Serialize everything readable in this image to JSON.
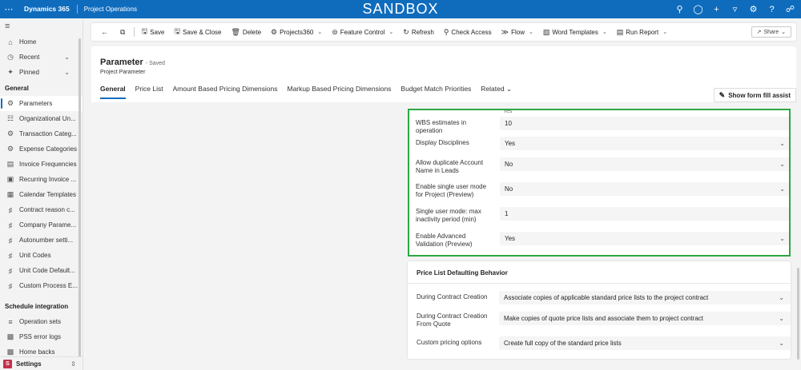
{
  "topbar": {
    "app_name": "Dynamics 365",
    "area_name": "Project Operations",
    "environment": "SANDBOX",
    "icons": [
      "search-icon",
      "lightbulb-icon",
      "plus-icon",
      "filter-icon",
      "gear-icon",
      "help-icon",
      "copilot-icon"
    ],
    "brand_color": "#0f6cbd"
  },
  "sidebar": {
    "top_items": [
      {
        "label": "Home",
        "icon": "home-icon"
      },
      {
        "label": "Recent",
        "icon": "clock-icon"
      },
      {
        "label": "Pinned",
        "icon": "pin-icon"
      }
    ],
    "sections": [
      {
        "title": "General",
        "items": [
          {
            "label": "Parameters",
            "icon": "gear-icon",
            "active": true
          },
          {
            "label": "Organizational Un...",
            "icon": "org-icon"
          },
          {
            "label": "Transaction Categ...",
            "icon": "gear-icon"
          },
          {
            "label": "Expense Categories",
            "icon": "gear-icon"
          },
          {
            "label": "Invoice Frequencies",
            "icon": "invoice-icon"
          },
          {
            "label": "Recurring Invoice ...",
            "icon": "recurring-icon"
          },
          {
            "label": "Calendar Templates",
            "icon": "calendar-icon"
          },
          {
            "label": "Contract reason c...",
            "icon": "puzzle-icon"
          },
          {
            "label": "Company Parame...",
            "icon": "puzzle-icon"
          },
          {
            "label": "Autonumber setti...",
            "icon": "puzzle-icon"
          },
          {
            "label": "Unit Codes",
            "icon": "puzzle-icon"
          },
          {
            "label": "Unit Code Default...",
            "icon": "puzzle-icon"
          },
          {
            "label": "Custom Process E...",
            "icon": "puzzle-icon"
          }
        ]
      },
      {
        "title": "Schedule integration",
        "items": [
          {
            "label": "Operation sets",
            "icon": "list-icon"
          },
          {
            "label": "PSS error logs",
            "icon": "document-icon"
          },
          {
            "label": "Home backs",
            "icon": "document-icon"
          }
        ]
      }
    ],
    "settings": {
      "badge": "S",
      "label": "Settings"
    }
  },
  "commandbar": {
    "items": [
      {
        "label": "Save",
        "icon": "save-icon"
      },
      {
        "label": "Save & Close",
        "icon": "save-close-icon"
      },
      {
        "label": "Delete",
        "icon": "delete-icon"
      },
      {
        "label": "Projects360",
        "icon": "gear-icon",
        "dropdown": true
      },
      {
        "label": "Feature Control",
        "icon": "sliders-icon",
        "dropdown": true
      },
      {
        "label": "Refresh",
        "icon": "refresh-icon"
      },
      {
        "label": "Check Access",
        "icon": "key-icon"
      },
      {
        "label": "Flow",
        "icon": "flow-icon",
        "dropdown": true
      },
      {
        "label": "Word Templates",
        "icon": "word-icon",
        "dropdown": true
      },
      {
        "label": "Run Report",
        "icon": "report-icon",
        "dropdown": true
      }
    ],
    "share_label": "Share"
  },
  "form": {
    "title": "Parameter",
    "saved_status": "- Saved",
    "entity": "Project Parameter",
    "tabs": [
      "General",
      "Price List",
      "Amount Based Pricing Dimensions",
      "Markup Based Pricing Dimensions",
      "Budget Match Priorities",
      "Related"
    ],
    "form_assist_label": "Show form fill assist"
  },
  "highlighted_section": {
    "partial_top_value": "Yes",
    "fields": [
      {
        "label": "WBS estimates in operation",
        "value": "10",
        "dropdown": false
      },
      {
        "label": "Display Disciplines",
        "value": "Yes",
        "dropdown": true
      },
      {
        "label": "Allow duplicate Account Name in Leads",
        "value": "No",
        "dropdown": true
      },
      {
        "label": "Enable single user mode for Project (Preview)",
        "value": "No",
        "dropdown": true
      },
      {
        "label": "Single user mode: max inactivity period (min)",
        "value": "1",
        "dropdown": false
      },
      {
        "label": "Enable Advanced Validation (Preview)",
        "value": "Yes",
        "dropdown": true
      }
    ],
    "highlight_color": "#2da744"
  },
  "price_list_section": {
    "title": "Price List Defaulting Behavior",
    "fields": [
      {
        "label": "During Contract Creation",
        "value": "Associate copies of applicable standard price lists to the project contract"
      },
      {
        "label": "During Contract Creation From Quote",
        "value": "Make copies of quote price lists and associate them to project contract"
      },
      {
        "label": "Custom pricing options",
        "value": "Create full copy of the standard price lists"
      }
    ]
  }
}
